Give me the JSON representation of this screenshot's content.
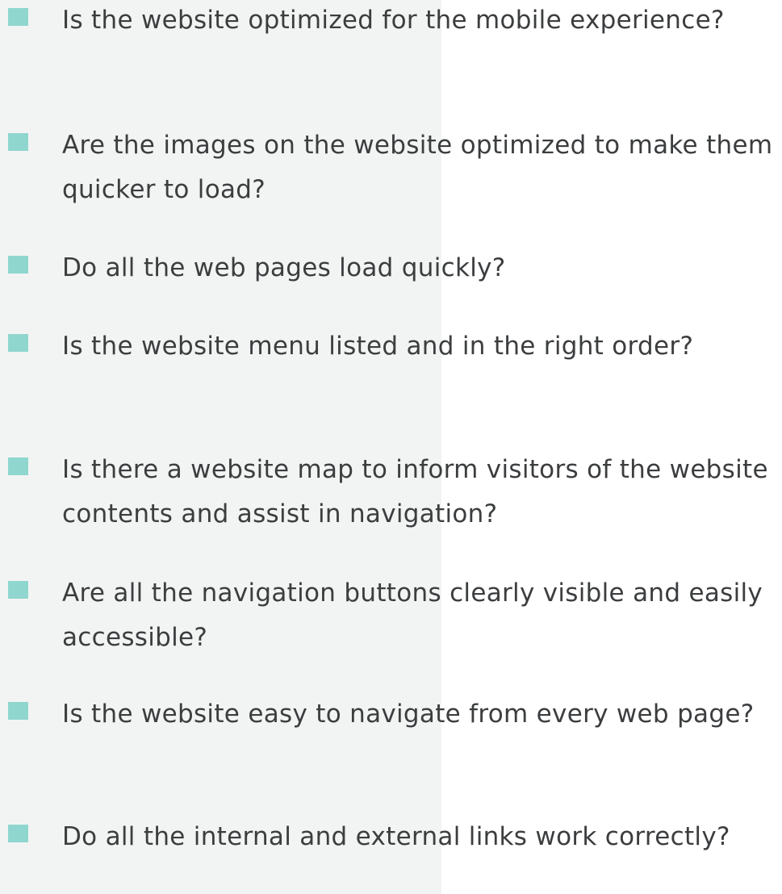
{
  "checklist": {
    "items": [
      {
        "text": "Is the website optimized for the mobile experience?"
      },
      {
        "text": "Are the images on the website optimized to make them quicker to load?"
      },
      {
        "text": "Do all the web pages load quickly?"
      },
      {
        "text": "Is the website menu listed and in the right order?"
      },
      {
        "text": "Is there a website map to inform visitors of the website contents and assist in navigation?"
      },
      {
        "text": "Are all the navigation buttons clearly visible and easily accessible?"
      },
      {
        "text": "Is the website easy to navigate from every web page?"
      },
      {
        "text": "Do all the internal and external links work correctly?"
      }
    ]
  },
  "colors": {
    "checkbox": "#8fd6cf",
    "panel": "#f2f4f3",
    "text": "#3b3d3f",
    "background": "#ffffff"
  }
}
